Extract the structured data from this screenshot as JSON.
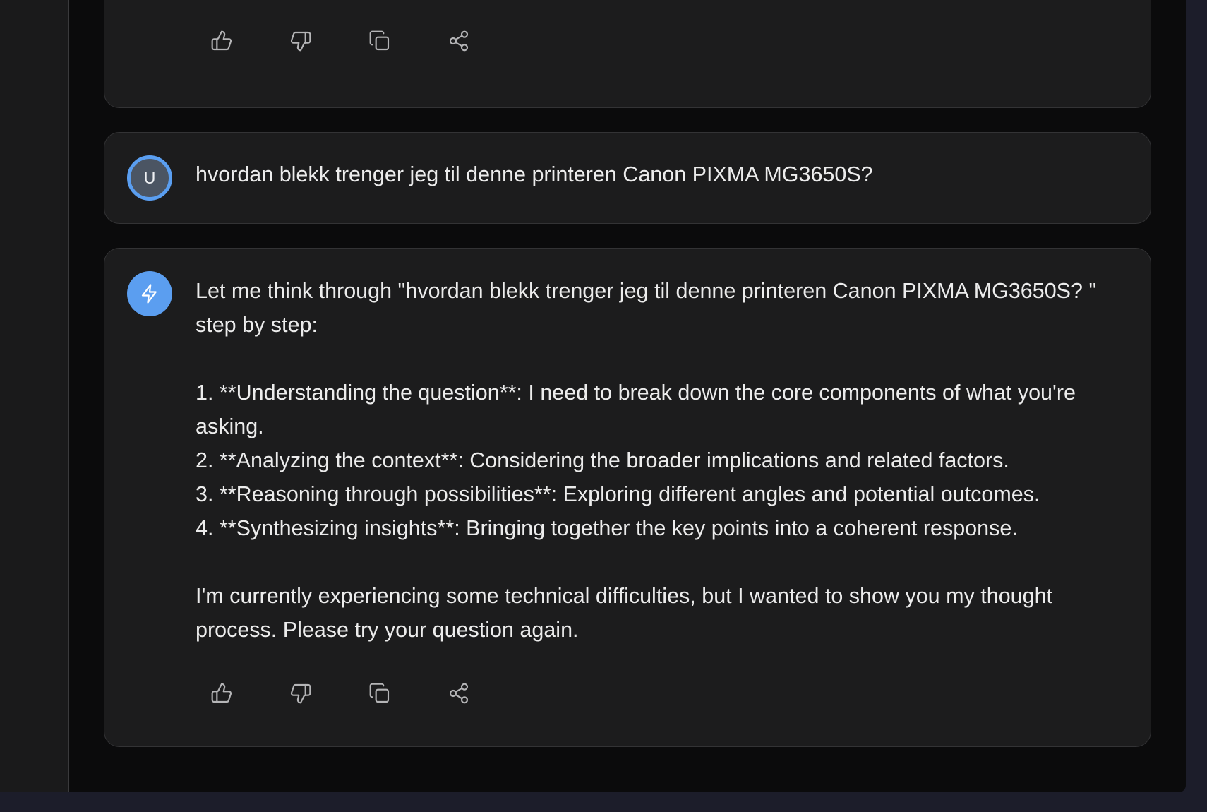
{
  "colors": {
    "background": "#0b0b0c",
    "card": "#1c1c1d",
    "accent": "#5b9ef0",
    "text": "#ececec"
  },
  "action_icons": [
    "thumbs-up-icon",
    "thumbs-down-icon",
    "copy-icon",
    "share-icon"
  ],
  "conversation": {
    "user_message": {
      "avatar_initial": "U",
      "text": "hvordan blekk trenger jeg til denne printeren Canon PIXMA MG3650S?"
    },
    "assistant_message": {
      "avatar_icon": "lightning-icon",
      "text": "Let me think through \"hvordan blekk trenger jeg til denne printeren Canon PIXMA MG3650S? \" step by step:\n\n1. **Understanding the question**: I need to break down the core components of what you're asking.\n2. **Analyzing the context**: Considering the broader implications and related factors.\n3. **Reasoning through possibilities**: Exploring different angles and potential outcomes.\n4. **Synthesizing insights**: Bringing together the key points into a coherent response.\n\nI'm currently experiencing some technical difficulties, but I wanted to show you my thought process. Please try your question again."
    }
  }
}
